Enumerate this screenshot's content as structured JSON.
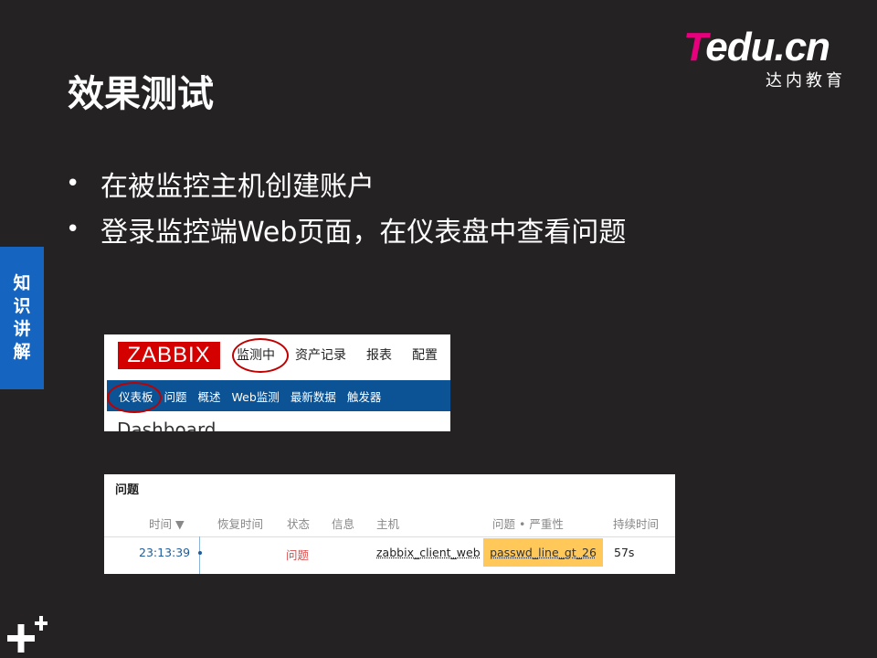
{
  "slide": {
    "title": "效果测试",
    "bullets": [
      "在被监控主机创建账户",
      "登录监控端Web页面，在仪表盘中查看问题"
    ],
    "bullet_marker": "•",
    "side_tab": [
      "知",
      "识",
      "讲",
      "解"
    ]
  },
  "logo": {
    "word_first": "T",
    "word_rest": "edu.cn",
    "subtitle": "达内教育",
    "accent": "#e6007e"
  },
  "zabbix_nav": {
    "logo_text": "ZABBIX",
    "top_menu": [
      "监测中",
      "资产记录",
      "报表",
      "配置"
    ],
    "sub_menu": [
      "仪表板",
      "问题",
      "概述",
      "Web监测",
      "最新数据",
      "触发器"
    ],
    "page_heading": "Dashboard",
    "brand_color": "#d40000",
    "nav_color": "#0b5394"
  },
  "problems_panel": {
    "title": "问题",
    "headers": {
      "time": "时间 ▼",
      "recovery": "恢复时间",
      "status": "状态",
      "info": "信息",
      "host": "主机",
      "problem": "问题 • 严重性",
      "duration": "持续时间"
    },
    "row": {
      "time": "23:13:39",
      "status": "问题",
      "host": "zabbix_client_web",
      "problem": "passwd_line_gt_26",
      "duration": "57s"
    },
    "severity_color": "#ffc859"
  }
}
